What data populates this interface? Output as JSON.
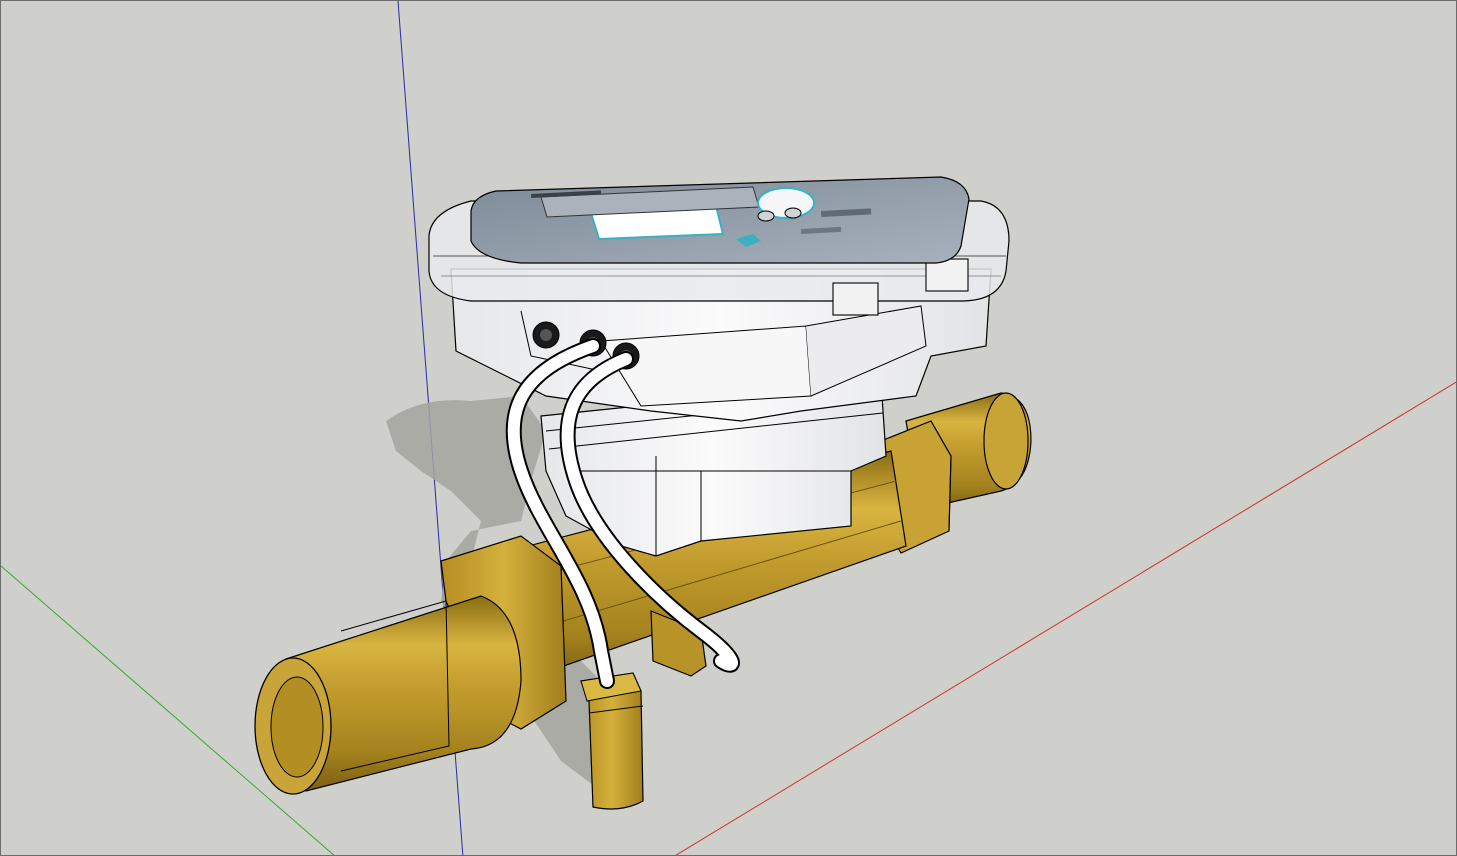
{
  "viewport": {
    "background": "#cfcfcb",
    "axes": {
      "red_axis_color": "#cc3333",
      "green_axis_color": "#33aa33",
      "blue_axis_color": "#2a2aa8"
    }
  },
  "model": {
    "subject": "ultrasonic-water-meter-3d-model",
    "brass_color": "#c4a032",
    "housing_color": "#f4f5f6",
    "faceplate_color": "#8e9aa6",
    "cable_color": "#ffffff"
  }
}
